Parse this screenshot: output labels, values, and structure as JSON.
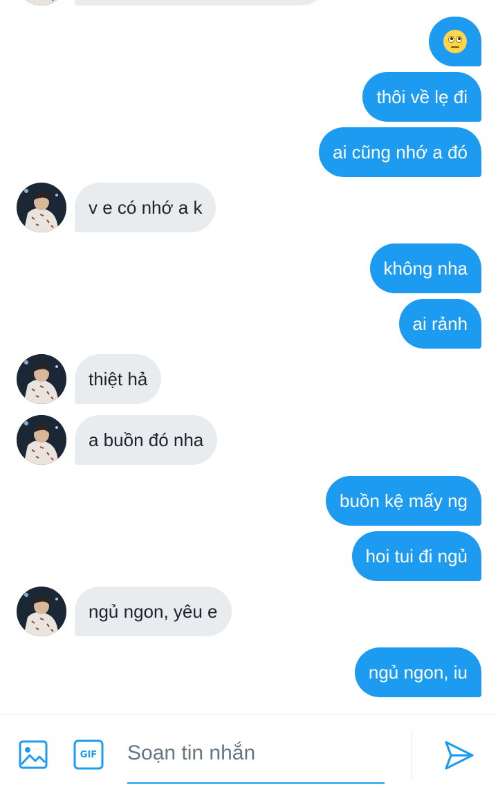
{
  "conversation": {
    "messages": [
      {
        "side": "in",
        "text": ""
      },
      {
        "side": "out",
        "text": "",
        "emoji": "face-with-rolling-eyes"
      },
      {
        "side": "out",
        "text": "thôi về lẹ đi"
      },
      {
        "side": "out",
        "text": "ai cũng nhớ a đó"
      },
      {
        "side": "in",
        "text": "v e có nhớ a k"
      },
      {
        "side": "out",
        "text": "không nha"
      },
      {
        "side": "out",
        "text": "ai rảnh"
      },
      {
        "side": "in",
        "text": "thiệt hả"
      },
      {
        "side": "in",
        "text": "a buồn đó nha"
      },
      {
        "side": "out",
        "text": "buồn kệ mấy ng"
      },
      {
        "side": "out",
        "text": "hoi tui đi ngủ"
      },
      {
        "side": "in",
        "text": "ngủ ngon, yêu e"
      },
      {
        "side": "out",
        "text": "ngủ ngon, iu"
      }
    ]
  },
  "composer": {
    "placeholder": "Soạn tin nhắn",
    "value": "",
    "gif_label": "GIF",
    "icons": {
      "media": "image-icon",
      "gif": "gif-icon",
      "send": "send-icon"
    }
  },
  "colors": {
    "accent": "#1d9bf0",
    "incoming_bubble": "#e8ecef",
    "incoming_text": "#1f2328",
    "outgoing_text": "#ffffff"
  }
}
